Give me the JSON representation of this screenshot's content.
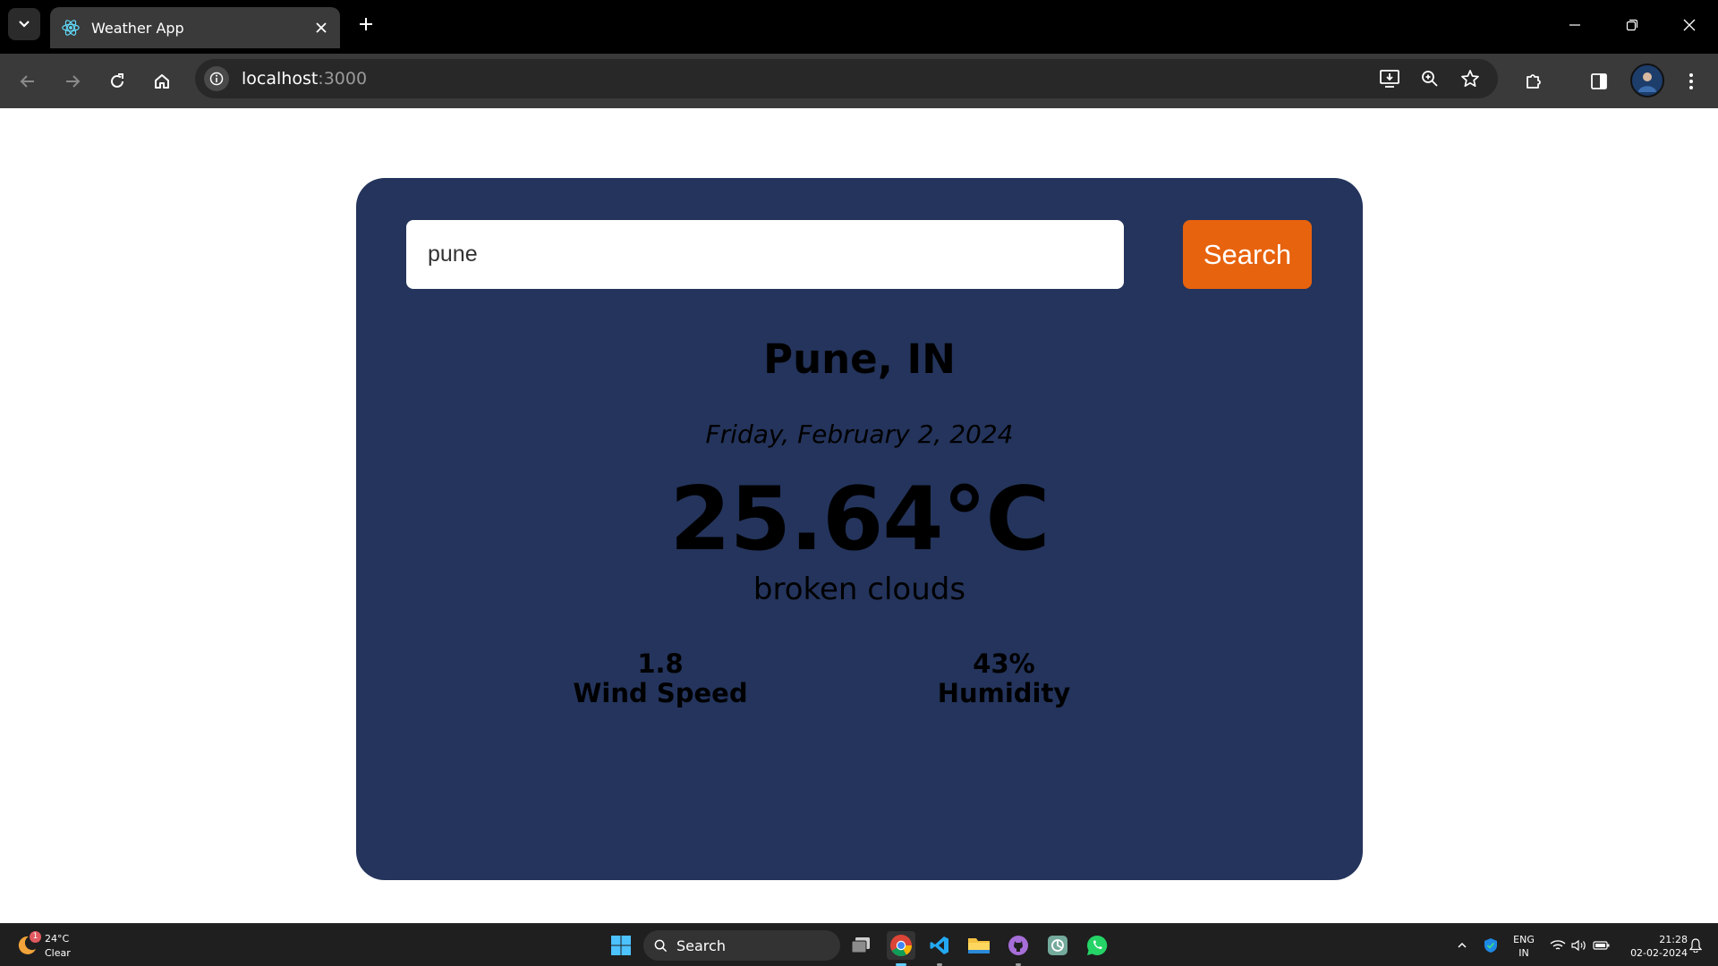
{
  "browser": {
    "tab_title": "Weather App",
    "tab_favicon": "react-icon",
    "url_host": "localhost",
    "url_port": ":3000"
  },
  "app": {
    "search": {
      "value": "pune",
      "button_label": "Search"
    },
    "city": "Pune, IN",
    "date": "Friday, February 2, 2024",
    "temperature": "25.64°C",
    "description": "broken clouds",
    "wind": {
      "value": "1.8",
      "label": "Wind Speed"
    },
    "humidity": {
      "value": "43%",
      "label": "Humidity"
    },
    "colors": {
      "card": "#24345c",
      "button": "#e8630e",
      "page": "#ffffff"
    }
  },
  "taskbar": {
    "weather_temp": "24°C",
    "weather_condition": "Clear",
    "weather_badge": "1",
    "search_label": "Search",
    "lang_line1": "ENG",
    "lang_line2": "IN",
    "time": "21:28",
    "date": "02-02-2024",
    "apps": [
      "windows-start-icon",
      "task-view-icon",
      "chrome-icon",
      "vscode-icon",
      "file-explorer-icon",
      "github-icon",
      "chatgpt-icon",
      "whatsapp-icon"
    ]
  }
}
